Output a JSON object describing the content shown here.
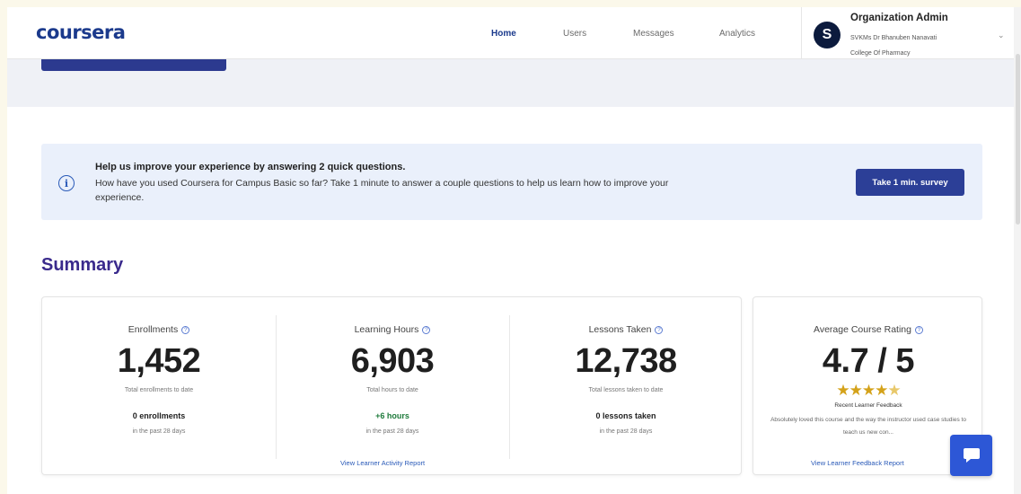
{
  "header": {
    "logo": "coursera",
    "nav": [
      {
        "label": "Home",
        "active": true
      },
      {
        "label": "Users",
        "active": false
      },
      {
        "label": "Messages",
        "active": false
      },
      {
        "label": "Analytics",
        "active": false
      }
    ],
    "avatar_initial": "S",
    "org_title": "Organization Admin",
    "org_subtitle_line1": "SVKMs Dr Bhanuben Nanavati",
    "org_subtitle_line2": "College Of Pharmacy"
  },
  "banner": {
    "title": "Help us improve your experience by answering 2 quick questions.",
    "body": "How have you used Coursera for Campus Basic so far? Take 1 minute to answer a couple questions to help us learn how to improve your experience.",
    "button": "Take 1 min. survey"
  },
  "summary": {
    "title": "Summary",
    "metrics": [
      {
        "label": "Enrollments",
        "value": "1,452",
        "desc": "Total enrollments to date",
        "recent": "0 enrollments",
        "period": "in the past 28 days"
      },
      {
        "label": "Learning Hours",
        "value": "6,903",
        "desc": "Total hours to date",
        "recent": "+6 hours",
        "period": "in the past 28 days"
      },
      {
        "label": "Lessons Taken",
        "value": "12,738",
        "desc": "Total lessons taken to date",
        "recent": "0 lessons taken",
        "period": "in the past 28 days"
      }
    ],
    "activity_link": "View Learner Activity Report",
    "rating": {
      "label": "Average Course Rating",
      "value": "4.7 / 5",
      "stars": 4.7,
      "feedback_label": "Recent Learner Feedback",
      "feedback_text": "Absolutely loved this course and the way the instructor used case studies to teach us new con...",
      "link": "View Learner Feedback Report"
    }
  },
  "colors": {
    "brand": "#1b3a8c",
    "button": "#2c3f97",
    "summary_title": "#3a2a8c",
    "banner_bg": "#eaf0fb",
    "positive": "#1d7a3a",
    "chat": "#2d57d6"
  },
  "icons": [
    "info-icon",
    "help-icon",
    "chevron-down-icon",
    "star-icon",
    "chat-icon"
  ]
}
